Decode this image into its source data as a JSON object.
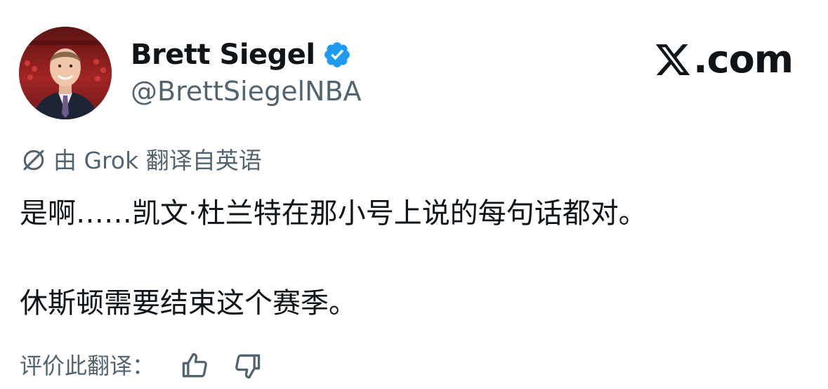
{
  "author": {
    "name": "Brett Siegel",
    "handle": "@BrettSiegelNBA",
    "verified": true,
    "avatar_icon": "profile-photo-avatar"
  },
  "brand": {
    "text": ".com",
    "logo_icon": "x-logo-icon"
  },
  "translation": {
    "icon": "grok-icon",
    "label": "由 Grok 翻译自英语"
  },
  "tweet": {
    "line1": "是啊……凯文·杜兰特在那小号上说的每句话都对。",
    "line2": "休斯顿需要结束这个赛季。"
  },
  "rating": {
    "label": "评价此翻译：",
    "up_icon": "thumbs-up-icon",
    "down_icon": "thumbs-down-icon"
  },
  "colors": {
    "text_primary": "#0f1419",
    "text_secondary": "#536471",
    "verified_blue": "#1d9bf0",
    "background": "#ffffff"
  }
}
